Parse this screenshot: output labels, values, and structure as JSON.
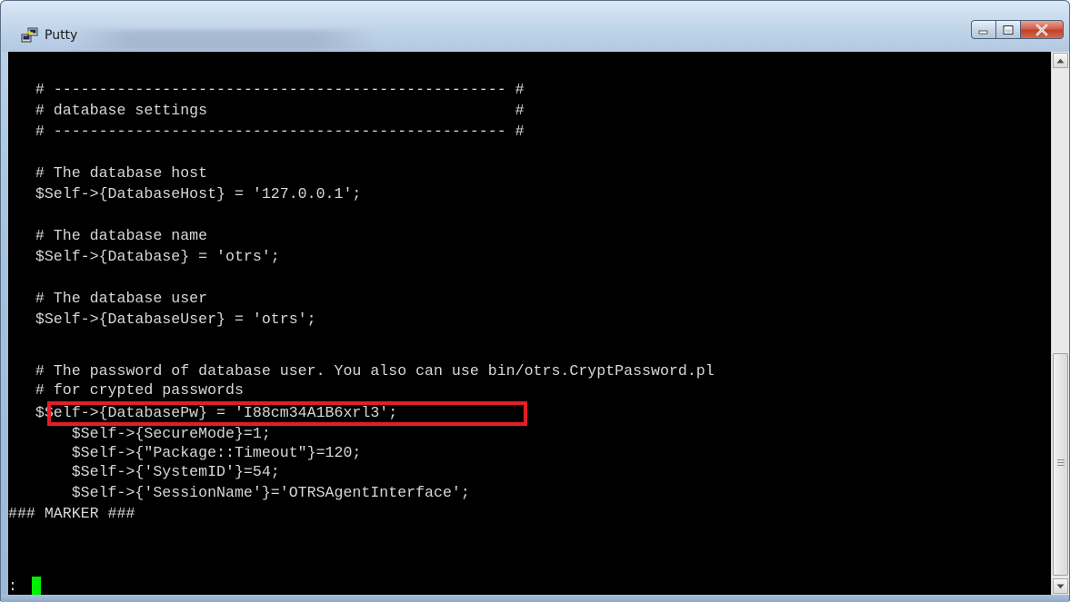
{
  "window": {
    "title": "Putty",
    "buttons": {
      "minimize": "minimize",
      "maximize": "maximize",
      "close": "close"
    }
  },
  "terminal": {
    "lines": [
      "   # -------------------------------------------------- #",
      "   # database settings                                  #",
      "   # -------------------------------------------------- #",
      "",
      "   # The database host",
      "   $Self->{DatabaseHost} = '127.0.0.1';",
      "",
      "   # The database name",
      "   $Self->{Database} = 'otrs';",
      "",
      "   # The database user",
      "   $Self->{DatabaseUser} = 'otrs';",
      "",
      "   # The password of database user. You also can use bin/otrs.CryptPassword.pl",
      "   # for crypted passwords",
      "   $Self->{DatabasePw} = 'I88cm34A1B6xrl3';",
      "       $Self->{SecureMode}=1;",
      "       $Self->{\"Package::Timeout\"}=120;",
      "       $Self->{'SystemID'}=54;",
      "       $Self->{'SessionName'}='OTRSAgentInterface';",
      "### MARKER ###",
      "",
      "",
      ":"
    ],
    "highlight_color": "#e41e26",
    "cursor_color": "#00ee00",
    "text_color": "#d7d7d7",
    "background_color": "#000000"
  },
  "icons": {
    "app": "putty-icon",
    "scroll_up": "scroll-up-arrow-icon",
    "scroll_down": "scroll-down-arrow-icon"
  }
}
